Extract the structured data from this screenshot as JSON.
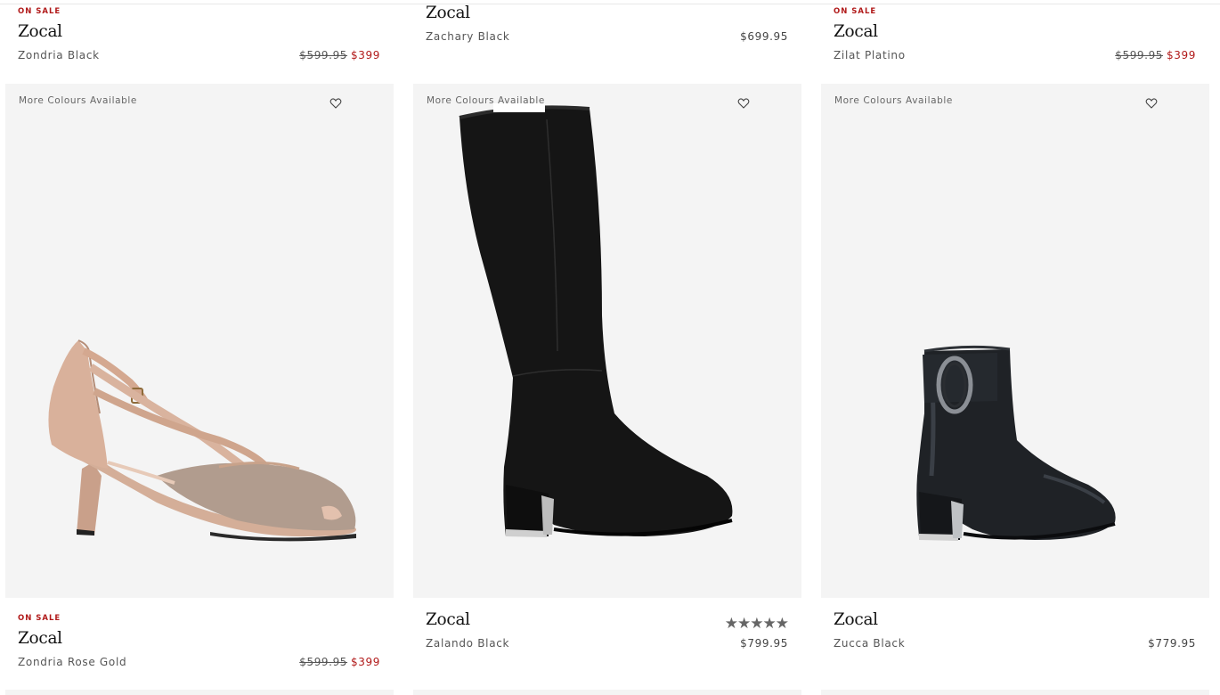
{
  "products_top": [
    {
      "sale_badge": "ON SALE",
      "brand": "Zocal",
      "name": "Zondria Black",
      "old_price": "$599.95",
      "price": "$399"
    },
    {
      "sale_badge": "",
      "brand": "Zocal",
      "name": "Zachary Black",
      "old_price": "",
      "price": "$699.95"
    },
    {
      "sale_badge": "ON SALE",
      "brand": "Zocal",
      "name": "Zilat Platino",
      "old_price": "$599.95",
      "price": "$399"
    }
  ],
  "products": [
    {
      "more_colours": "More Colours Available",
      "sale_badge": "ON SALE",
      "brand": "Zocal",
      "name": "Zondria Rose Gold",
      "old_price": "$599.95",
      "price": "$399"
    },
    {
      "more_colours": "More Colours Available",
      "sale_badge": "",
      "brand": "Zocal",
      "name": "Zalando Black",
      "old_price": "",
      "price": "$799.95",
      "rating_stars": "★★★★★",
      "rating": 5
    },
    {
      "more_colours": "More Colours Available",
      "sale_badge": "",
      "brand": "Zocal",
      "name": "Zucca Black",
      "old_price": "",
      "price": "$779.95"
    }
  ],
  "icons": {
    "wishlist": "heart-outline-icon"
  },
  "colors": {
    "sale": "#b11a1a",
    "tile_bg": "#f4f4f4"
  }
}
